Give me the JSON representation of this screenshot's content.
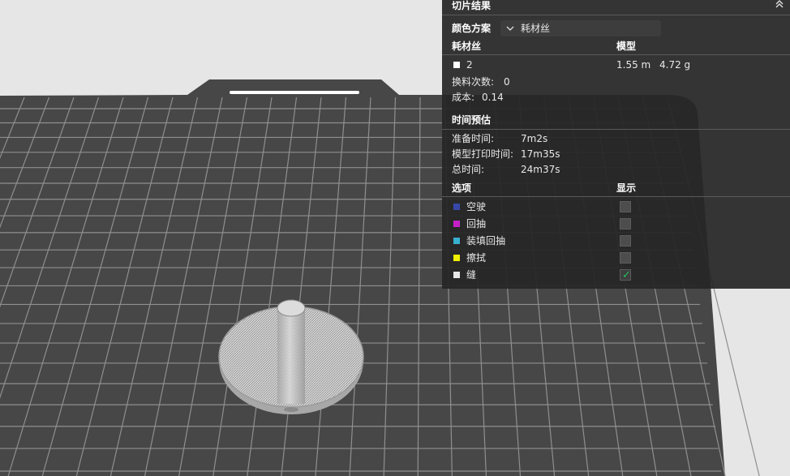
{
  "panel": {
    "title": "切片结果",
    "collapse_icon": "double-chevron-up-icon",
    "color_scheme": {
      "label": "颜色方案",
      "selected": "耗材丝",
      "icon": "chevron-down-icon"
    },
    "filament_table": {
      "col_filament": "耗材丝",
      "col_model": "模型",
      "rows": [
        {
          "swatch_color": "#ffffff",
          "name": "2",
          "length": "1.55 m",
          "weight": "4.72 g"
        }
      ]
    },
    "change_count": {
      "label": "换料次数:",
      "value": "0"
    },
    "cost": {
      "label": "成本:",
      "value": "0.14"
    },
    "time_estimate": {
      "title": "时间预估",
      "prepare_label": "准备时间:",
      "prepare_value": "7m2s",
      "model_print_label": "模型打印时间:",
      "model_print_value": "17m35s",
      "total_label": "总时间:",
      "total_value": "24m37s"
    },
    "options": {
      "col_option": "选项",
      "col_display": "显示",
      "items": [
        {
          "label": "空驶",
          "color": "#3848a8",
          "checked": false
        },
        {
          "label": "回抽",
          "color": "#c820c8",
          "checked": false
        },
        {
          "label": "装填回抽",
          "color": "#38b0d0",
          "checked": false
        },
        {
          "label": "擦拭",
          "color": "#f0f000",
          "checked": false
        },
        {
          "label": "缝",
          "color": "#e8e8e8",
          "checked": true
        }
      ]
    }
  },
  "viewport": {
    "background_color": "#e6e6e6",
    "plate_color": "#474747",
    "grid_color": "#8e8e8e",
    "model_color": "#c8c8c8"
  }
}
